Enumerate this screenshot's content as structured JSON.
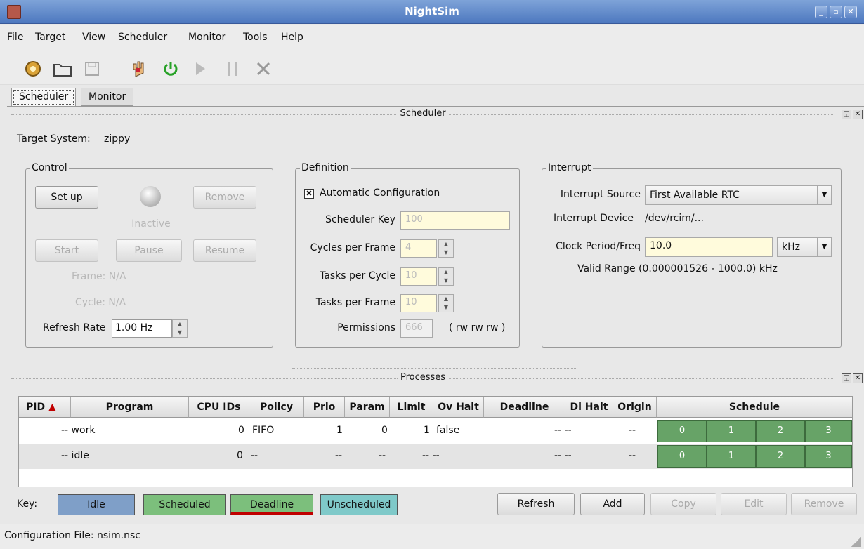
{
  "window": {
    "title": "NightSim"
  },
  "menu": [
    "File",
    "Target",
    "View",
    "Scheduler",
    "Monitor",
    "Tools",
    "Help"
  ],
  "tabs": [
    "Scheduler",
    "Monitor"
  ],
  "sched_dock_title": "Scheduler",
  "proc_dock_title": "Processes",
  "target": {
    "label": "Target System:",
    "value": "zippy"
  },
  "control": {
    "title": "Control",
    "setup": "Set up",
    "remove": "Remove",
    "state": "Inactive",
    "start": "Start",
    "pause": "Pause",
    "resume": "Resume",
    "frame": "Frame: N/A",
    "cycle": "Cycle: N/A",
    "refresh_label": "Refresh Rate",
    "refresh_value": "1.00 Hz"
  },
  "definition": {
    "title": "Definition",
    "auto": "Automatic Configuration",
    "key_label": "Scheduler Key",
    "key_value": "100",
    "cycles_label": "Cycles per Frame",
    "cycles_value": "4",
    "tasks_cycle_label": "Tasks per Cycle",
    "tasks_cycle_value": "10",
    "tasks_frame_label": "Tasks per Frame",
    "tasks_frame_value": "10",
    "perm_label": "Permissions",
    "perm_value": "666",
    "perm_text": "( rw rw rw )"
  },
  "interrupt": {
    "title": "Interrupt",
    "source_label": "Interrupt Source",
    "source_value": "First Available RTC",
    "device_label": "Interrupt Device",
    "device_value": "/dev/rcim/...",
    "clock_label": "Clock Period/Freq",
    "clock_value": "10.0",
    "unit": "kHz",
    "range": "Valid Range (0.000001526 - 1000.0) kHz"
  },
  "columns": [
    "PID",
    "Program",
    "CPU IDs",
    "Policy",
    "Prio",
    "Param",
    "Limit",
    "Ov Halt",
    "Deadline",
    "Dl Halt",
    "Origin",
    "Schedule"
  ],
  "rows": [
    {
      "pid": "",
      "program": "-- work",
      "cpu": "0",
      "policy": "FIFO",
      "prio": "1",
      "param": "0",
      "limit": "1",
      "ovhalt": "false",
      "deadline": "-- --",
      "dlhalt": "",
      "origin": "--",
      "sched": [
        "0",
        "1",
        "2",
        "3"
      ]
    },
    {
      "pid": "",
      "program": "-- idle",
      "cpu": "0",
      "policy": "--",
      "prio": "--",
      "param": "--",
      "limit": "-- --",
      "ovhalt": "",
      "deadline": "-- --",
      "dlhalt": "",
      "origin": "--",
      "sched": [
        "0",
        "1",
        "2",
        "3"
      ]
    }
  ],
  "key": {
    "label": "Key:",
    "idle": "Idle",
    "scheduled": "Scheduled",
    "deadline": "Deadline",
    "unscheduled": "Unscheduled"
  },
  "actions": {
    "refresh": "Refresh",
    "add": "Add",
    "copy": "Copy",
    "edit": "Edit",
    "remove": "Remove"
  },
  "status": "Configuration File: nsim.nsc",
  "colors": {
    "idle": "#7f9fc8",
    "scheduled": "#7cbf7c",
    "deadline_line": "#c00000",
    "unscheduled": "#7fc9c9"
  }
}
